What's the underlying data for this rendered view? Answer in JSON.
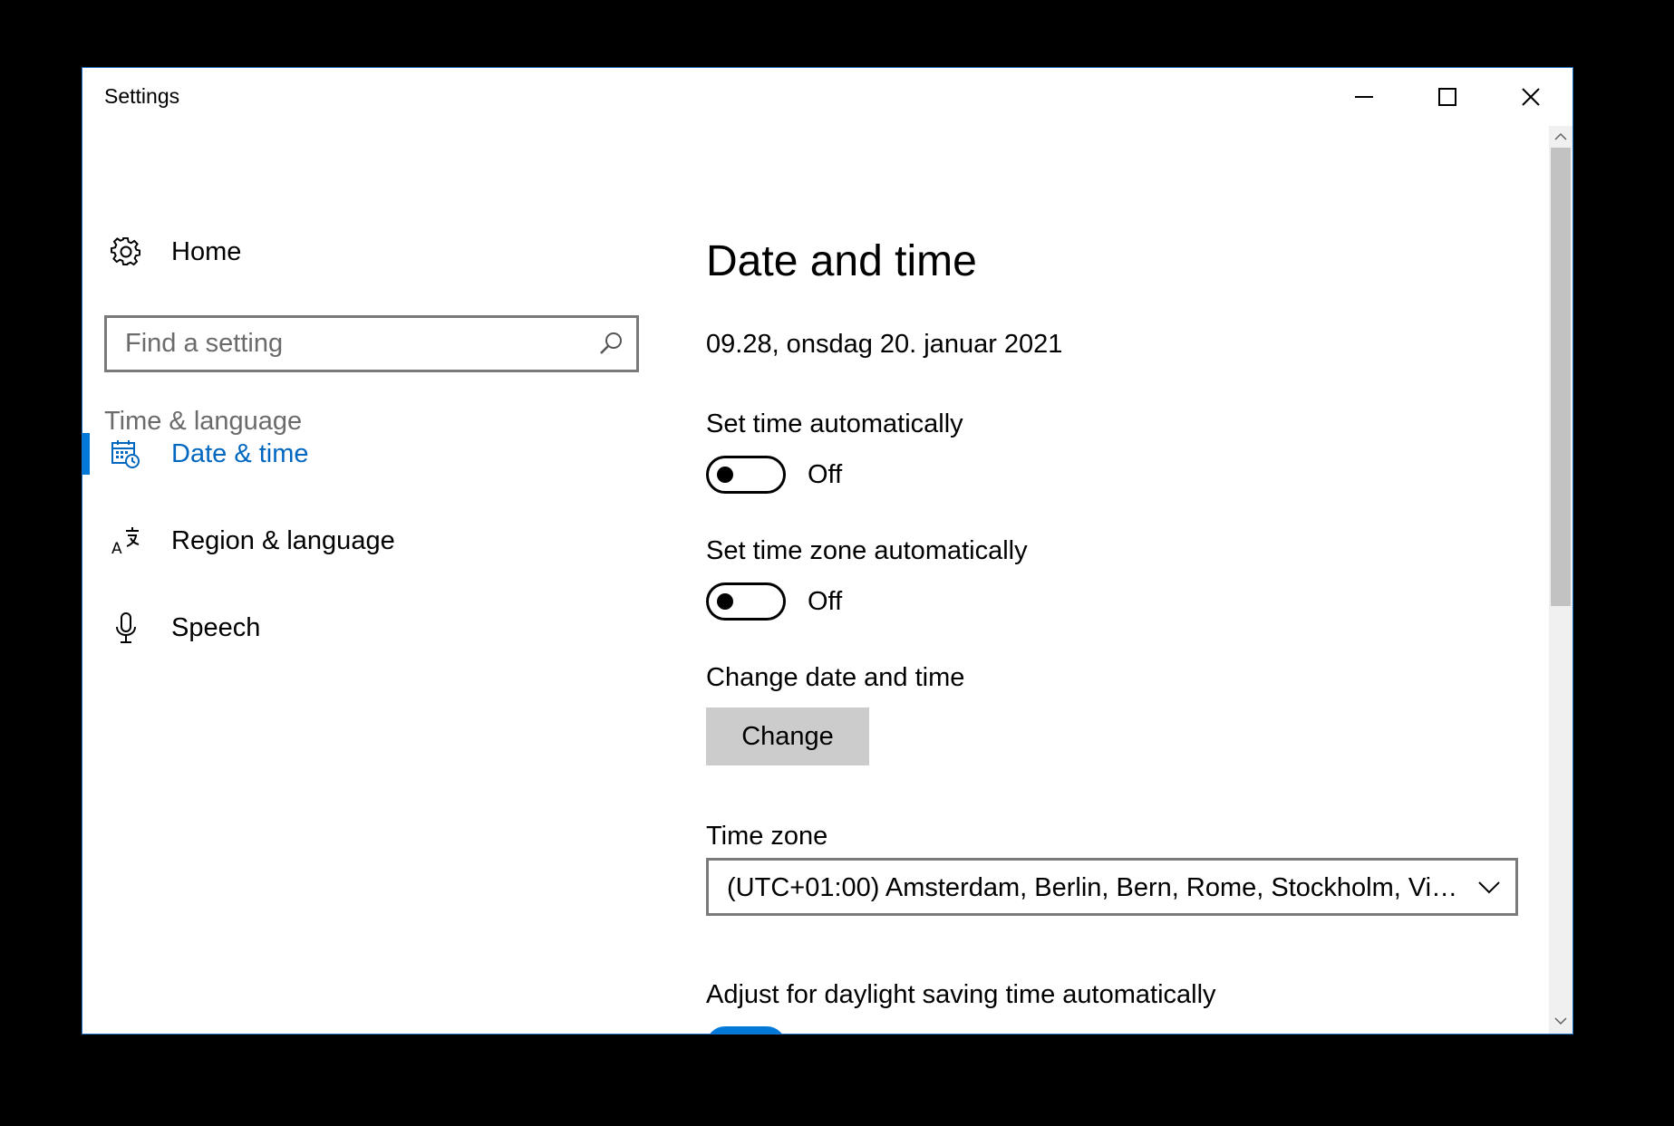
{
  "window": {
    "title": "Settings",
    "accent_color": "#0078d7",
    "caption_buttons": {
      "minimize": "minimize-icon",
      "maximize": "maximize-icon",
      "close": "close-icon"
    }
  },
  "sidebar": {
    "home": {
      "label": "Home",
      "icon": "gear-icon"
    },
    "search": {
      "placeholder": "Find a setting",
      "value": "",
      "icon": "search-icon"
    },
    "section_heading": "Time & language",
    "items": [
      {
        "label": "Date & time",
        "icon": "calendar-clock-icon",
        "selected": true
      },
      {
        "label": "Region & language",
        "icon": "language-icon",
        "selected": false
      },
      {
        "label": "Speech",
        "icon": "microphone-icon",
        "selected": false
      }
    ]
  },
  "main": {
    "title": "Date and time",
    "current_datetime": "09.28, onsdag 20. januar 2021",
    "set_time_automatically": {
      "label": "Set time automatically",
      "state": "Off",
      "on": false
    },
    "set_time_zone_automatically": {
      "label": "Set time zone automatically",
      "state": "Off",
      "on": false
    },
    "change_date_time": {
      "label": "Change date and time",
      "button_label": "Change"
    },
    "time_zone": {
      "label": "Time zone",
      "selected": "(UTC+01:00) Amsterdam, Berlin, Bern, Rome, Stockholm, Vie...",
      "icon": "chevron-down-icon"
    },
    "daylight_saving": {
      "label": "Adjust for daylight saving time automatically",
      "state": "On",
      "on": true
    }
  }
}
